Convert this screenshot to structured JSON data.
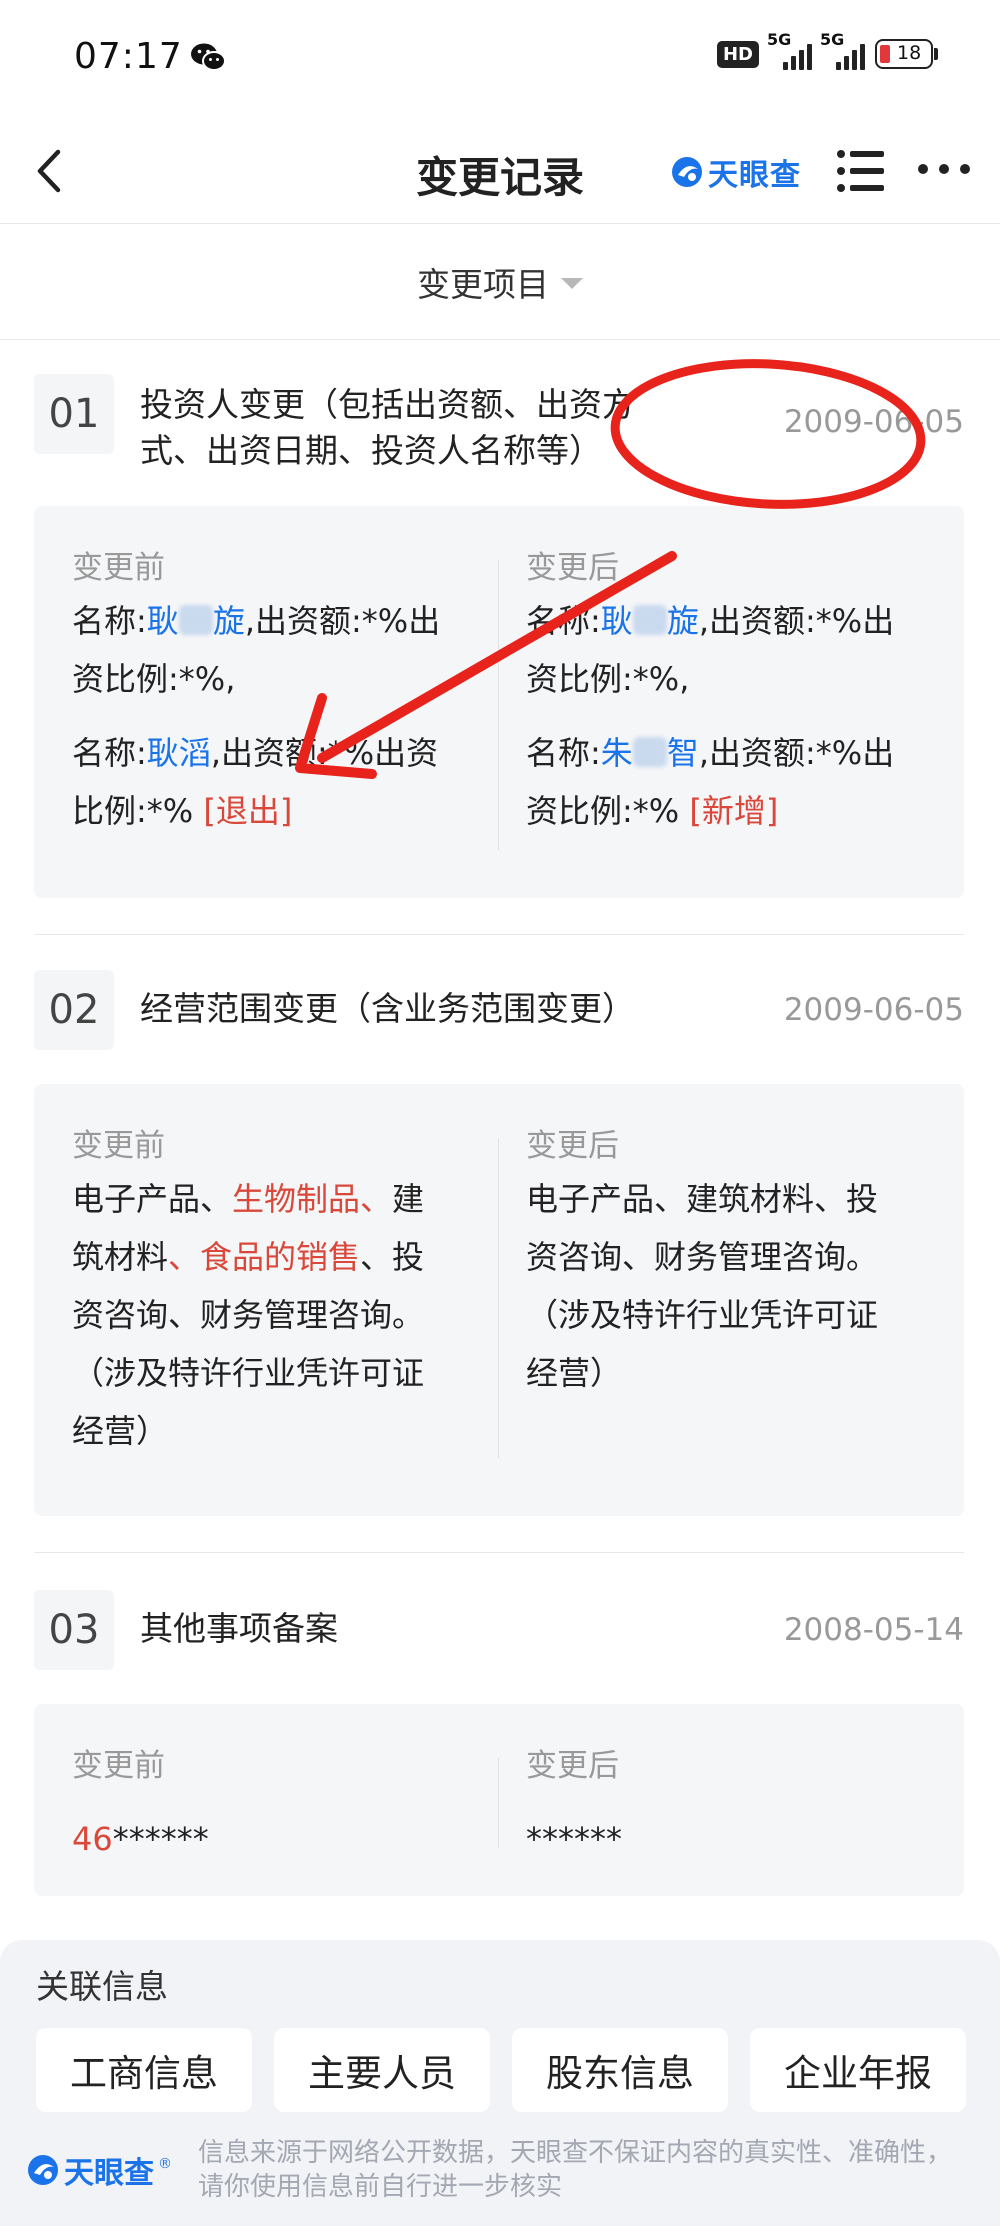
{
  "status_bar": {
    "time": "07:17",
    "hd_label": "HD",
    "signal1_label": "5G",
    "signal2_label": "5G",
    "battery": "18"
  },
  "nav": {
    "title": "变更记录",
    "brand": "天眼查"
  },
  "filter": {
    "label": "变更项目"
  },
  "records": [
    {
      "index": "01",
      "title_line1": "投资人变更（包括出资额、出资方",
      "title_line2": "式、出资日期、投资人名称等）",
      "date": "2009-06-05",
      "before_label": "变更前",
      "after_label": "变更后",
      "before": {
        "e1_prefix": "名称:",
        "e1_name_a": "耿",
        "e1_name_b": "旋",
        "e1_rest_line1": ",出资额:*%出",
        "e1_rest_line2": "资比例:*%,",
        "e2_prefix": "名称:",
        "e2_name": "耿滔",
        "e2_rest_line1": ",出资额:*%出资",
        "e2_rest_line2": "比例:*% ",
        "e2_tag": "[退出]"
      },
      "after": {
        "e1_prefix": "名称:",
        "e1_name_a": "耿",
        "e1_name_b": "旋",
        "e1_rest_line1": ",出资额:*%出",
        "e1_rest_line2": "资比例:*%,",
        "e2_prefix": "名称:",
        "e2_name_a": "朱",
        "e2_name_b": "智",
        "e2_rest_line1": ",出资额:*%出",
        "e2_rest_line2": "资比例:*% ",
        "e2_tag": "[新增]"
      }
    },
    {
      "index": "02",
      "title": "经营范围变更（含业务范围变更）",
      "date": "2009-06-05",
      "before_label": "变更前",
      "after_label": "变更后",
      "before": {
        "l1_a": "电子产品、",
        "l1_red": "生物制品、",
        "l1_b": "建",
        "l2_a": "筑材料",
        "l2_red": "、食品的销售",
        "l2_b": "、投",
        "l3": "资咨询、财务管理咨询。",
        "l4": "（涉及特许行业凭许可证",
        "l5": "经营）"
      },
      "after": {
        "l1": "电子产品、建筑材料、投",
        "l2": "资咨询、财务管理咨询。",
        "l3": "（涉及特许行业凭许可证",
        "l4": "经营）"
      }
    },
    {
      "index": "03",
      "title": "其他事项备案",
      "date": "2008-05-14",
      "before_label": "变更前",
      "after_label": "变更后",
      "before_red": "46",
      "before_rest": "******",
      "after": "******"
    }
  ],
  "related": {
    "title": "关联信息",
    "buttons": [
      "工商信息",
      "主要人员",
      "股东信息",
      "企业年报"
    ]
  },
  "footer": {
    "brand": "天眼查",
    "reg_mark": "®",
    "disclaimer_line1": "信息来源于网络公开数据，天眼查不保证内容的真实性、准确性，",
    "disclaimer_line2": "请你使用信息前自行进一步核实"
  },
  "colors": {
    "brand_blue": "#1a73e8",
    "highlight_red": "#d9483a",
    "annotation_red": "#e8231c"
  },
  "icons": [
    "back-arrow-icon",
    "wechat-icon",
    "list-icon",
    "more-icon",
    "tianyancha-logo-icon"
  ]
}
